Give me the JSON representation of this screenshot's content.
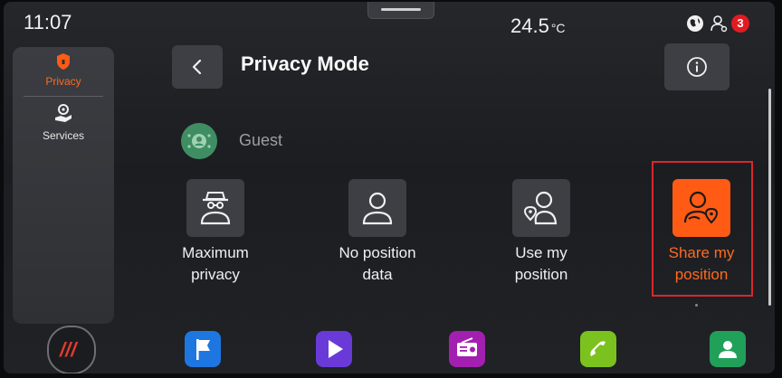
{
  "status": {
    "time": "11:07",
    "temperature": "24.5",
    "temperature_unit": "°C",
    "notification_count": "3",
    "icons": [
      "globe-icon",
      "location-user-icon"
    ]
  },
  "sidebar": {
    "items": [
      {
        "label": "Privacy",
        "icon": "shield-icon",
        "active": true
      },
      {
        "label": "Services",
        "icon": "services-icon",
        "active": false
      }
    ]
  },
  "header": {
    "title": "Privacy Mode"
  },
  "user": {
    "name": "Guest"
  },
  "options": [
    {
      "label_line1": "Maximum",
      "label_line2": "privacy",
      "icon": "incognito-icon"
    },
    {
      "label_line1": "No position",
      "label_line2": "data",
      "icon": "user-icon"
    },
    {
      "label_line1": "Use my",
      "label_line2": "position",
      "icon": "user-location-icon"
    },
    {
      "label_line1": "Share my",
      "label_line2": "position",
      "icon": "share-location-icon",
      "selected": true
    }
  ],
  "dock": {
    "apps": [
      "home-icon",
      "flag-icon",
      "play-icon",
      "radio-icon",
      "phone-icon",
      "contacts-icon"
    ]
  },
  "colors": {
    "accent": "#ff5b14",
    "highlight": "#d8282c",
    "badge": "#e11b22",
    "avatar": "#3f8d62"
  }
}
